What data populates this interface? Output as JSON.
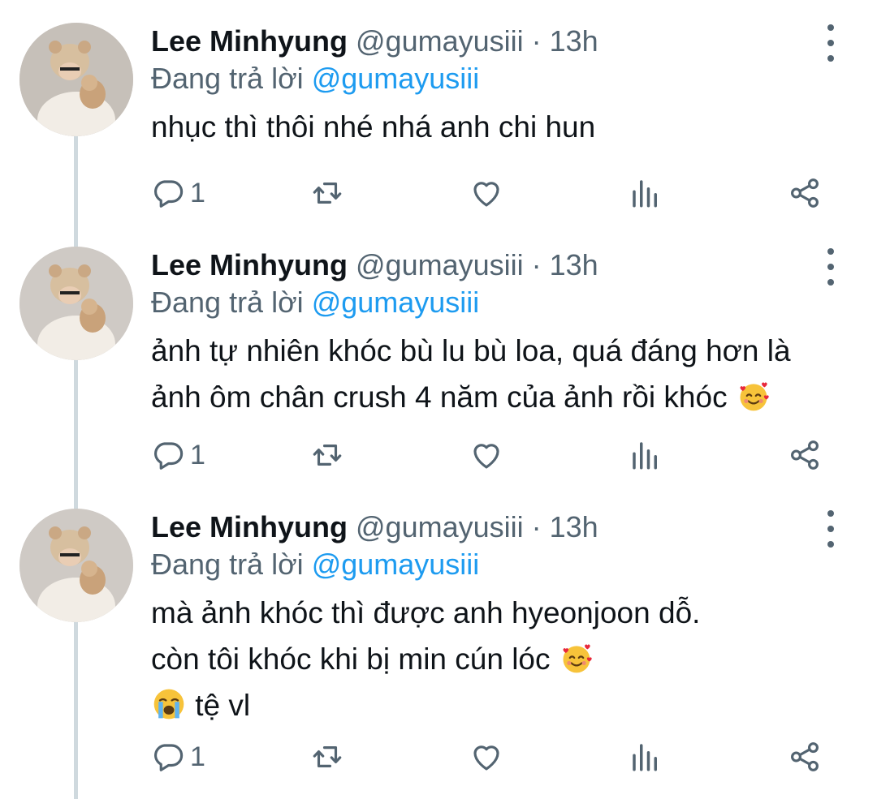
{
  "tweets": [
    {
      "name": "Lee Minhyung",
      "handle": "@gumayusiii",
      "sep": " · ",
      "time": "13h",
      "replying_prefix": "Đang trả lời ",
      "replying_to": "@gumayusiii",
      "lines": [
        "nhục thì thôi nhé nhá anh chi hun"
      ],
      "reply_count": "1"
    },
    {
      "name": "Lee Minhyung",
      "handle": "@gumayusiii",
      "sep": " · ",
      "time": "13h",
      "replying_prefix": "Đang trả lời ",
      "replying_to": "@gumayusiii",
      "lines": [
        "ảnh tự nhiên khóc bù lu bù loa, quá đáng hơn là",
        "ảnh ôm chân crush 4 năm của ảnh rồi khóc"
      ],
      "reply_count": "1"
    },
    {
      "name": "Lee Minhyung",
      "handle": "@gumayusiii",
      "sep": " · ",
      "time": "13h",
      "replying_prefix": "Đang trả lời ",
      "replying_to": "@gumayusiii",
      "lines": [
        "mà ảnh khóc thì được anh hyeonjoon dỗ.",
        "còn tôi khóc khi bị min cún lóc",
        "tệ vl"
      ],
      "reply_count": "1"
    }
  ],
  "icons": {
    "reply": "reply-icon",
    "retweet": "retweet-icon",
    "like": "heart-icon",
    "analytics": "analytics-icon",
    "share": "share-icon",
    "more": "more-vertical-icon",
    "smiling_hearts": "smiling-face-with-hearts-emoji",
    "crying": "loudly-crying-face-emoji"
  },
  "colors": {
    "text": "#0f1419",
    "secondary": "#536471",
    "link": "#1d9bf0",
    "thread_line": "#cfd9de"
  }
}
